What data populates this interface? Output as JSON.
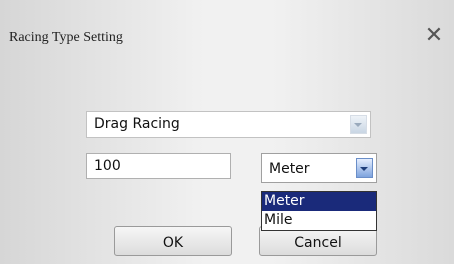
{
  "dialog": {
    "title": "Racing Type Setting",
    "close_icon": "close-icon"
  },
  "racing_type": {
    "selected": "Drag Racing",
    "arrow_icon": "chevron-down-icon"
  },
  "distance": {
    "value": "100"
  },
  "unit": {
    "selected": "Meter",
    "arrow_icon": "chevron-down-icon",
    "options": [
      "Meter",
      "Mile"
    ]
  },
  "buttons": {
    "ok_label": "OK",
    "cancel_label": "Cancel"
  },
  "colors": {
    "selection_highlight": "#1a2a7a"
  }
}
